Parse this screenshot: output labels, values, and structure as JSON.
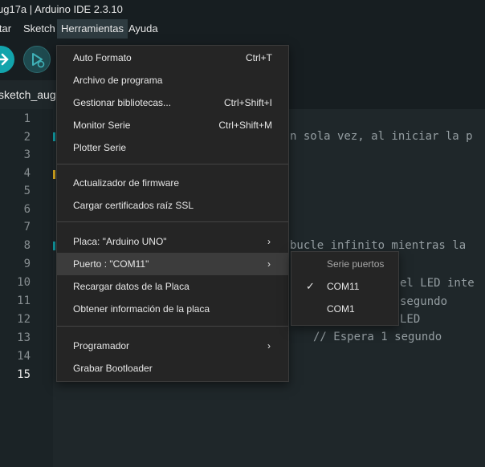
{
  "window": {
    "title": "ug17a | Arduino IDE 2.3.10"
  },
  "menubar": {
    "items": [
      "itar",
      "Sketch",
      "Herramientas",
      "Ayuda"
    ]
  },
  "tab": {
    "label": "sketch_aug"
  },
  "editor": {
    "line_numbers": [
      "1",
      "2",
      "3",
      "4",
      "5",
      "6",
      "7",
      "8",
      "9",
      "10",
      "11",
      "12",
      "13",
      "14",
      "15"
    ],
    "visible_code": [
      "n sola vez, al iniciar la p",
      "bucle infinito mientras la",
      "el LED inte",
      "segundo",
      "LED",
      "// Espera 1 segundo"
    ]
  },
  "dropdown": {
    "items": [
      {
        "label": "Auto Formato",
        "shortcut": "Ctrl+T"
      },
      {
        "label": "Archivo de programa",
        "shortcut": ""
      },
      {
        "label": "Gestionar bibliotecas...",
        "shortcut": "Ctrl+Shift+I"
      },
      {
        "label": "Monitor Serie",
        "shortcut": "Ctrl+Shift+M"
      },
      {
        "label": "Plotter Serie",
        "shortcut": ""
      },
      {
        "label": "Actualizador de firmware",
        "shortcut": ""
      },
      {
        "label": "Cargar certificados raíz SSL",
        "shortcut": ""
      },
      {
        "label": "Placa: \"Arduino UNO\"",
        "shortcut": ""
      },
      {
        "label": "Puerto : \"COM11\"",
        "shortcut": ""
      },
      {
        "label": "Recargar datos de la Placa",
        "shortcut": ""
      },
      {
        "label": "Obtener información de la placa",
        "shortcut": ""
      },
      {
        "label": "Programador",
        "shortcut": ""
      },
      {
        "label": "Grabar Bootloader",
        "shortcut": ""
      }
    ],
    "submenu_arrow": "›"
  },
  "submenu": {
    "header": "Serie puertos",
    "options": [
      "COM11",
      "COM1"
    ],
    "check": "✓"
  },
  "colors": {
    "accent": "#12a4ac",
    "menu_bg": "#252525",
    "editor_bg": "#1f272a"
  }
}
